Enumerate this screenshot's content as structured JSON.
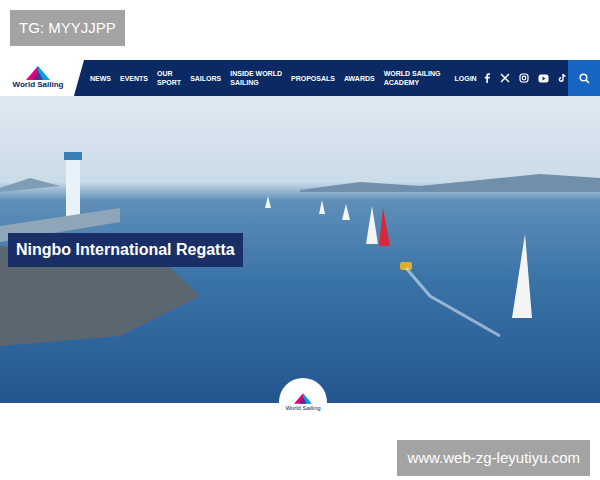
{
  "watermark_top": "TG: MYYJJPP",
  "logo": {
    "text": "World Sailing"
  },
  "nav": {
    "items": [
      "NEWS",
      "EVENTS",
      "OUR\nSPORT",
      "SAILORS",
      "INSIDE WORLD\nSAILING",
      "PROPOSALS",
      "AWARDS",
      "WORLD SAILING\nACADEMY"
    ],
    "login": "LOGIN"
  },
  "hero": {
    "caption": "Ningbo International Regatta"
  },
  "badge": {
    "text": "World Sailing"
  },
  "watermark_bottom": "www.web-zg-leyutiyu.com"
}
